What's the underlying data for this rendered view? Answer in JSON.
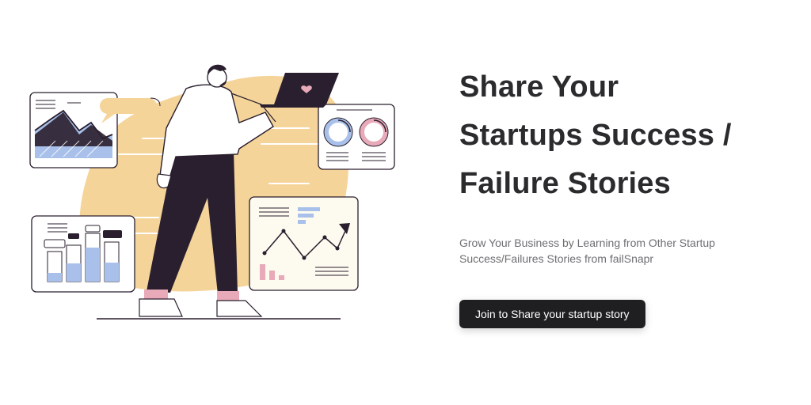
{
  "hero": {
    "title_line_1": "Share Your",
    "title_line_2": "Startups Success /",
    "title_line_3": "Failure Stories",
    "subtitle": "Grow Your Business by Learning from Other Startup Success/Failures Stories from failSnapr",
    "cta_label": "Join to Share your startup story"
  },
  "illustration": {
    "icon": "person-presenting-charts-illustration",
    "colors": {
      "accent": "#f5d49a",
      "ink": "#2a1f2e",
      "blue": "#a9c1ea",
      "pink": "#e8a9b8"
    }
  },
  "colors": {
    "title": "#2b2b2e",
    "subtitle": "#6e6e72",
    "button_bg": "#1f1f22",
    "button_text": "#ffffff"
  }
}
